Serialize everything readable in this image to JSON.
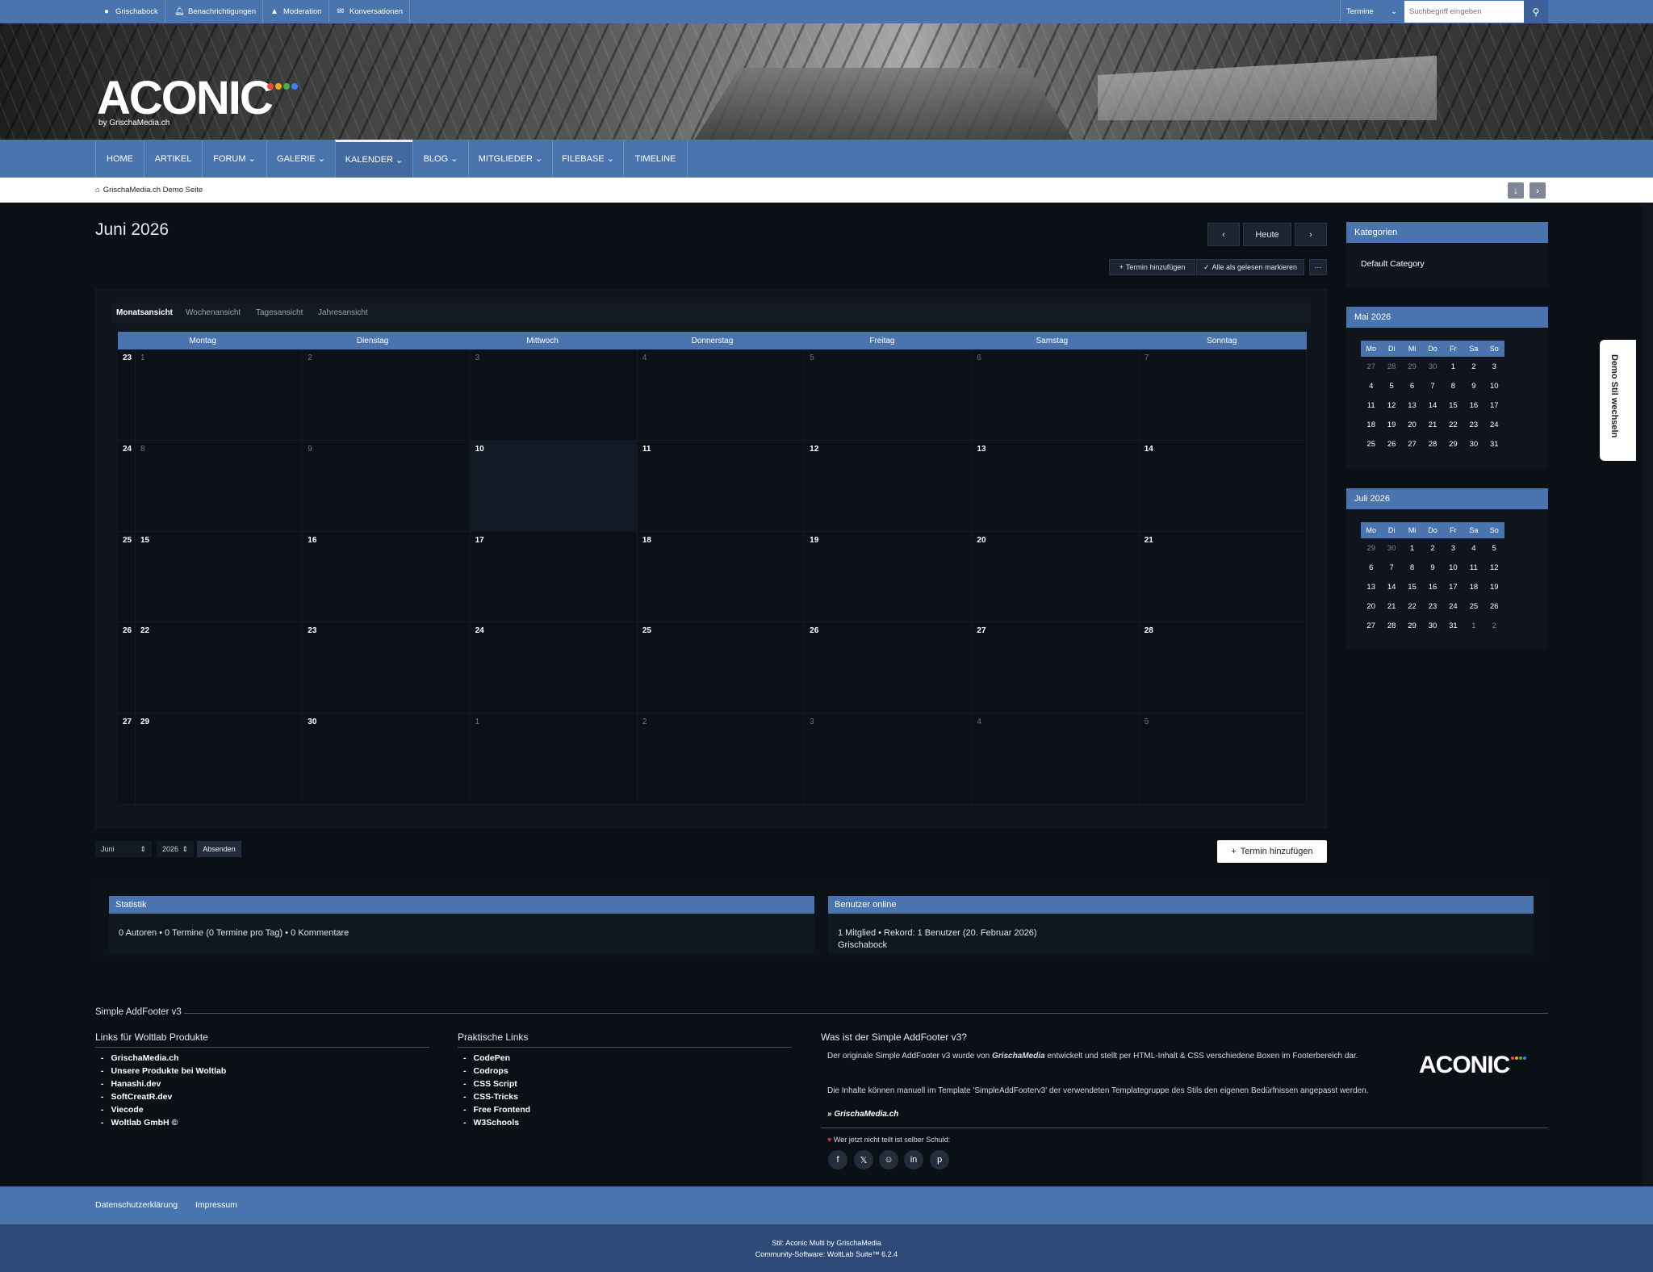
{
  "userbar": {
    "items": [
      "Grischabock",
      "Benachrichtigungen",
      "Moderation",
      "Konversationen"
    ],
    "search_scope": "Termine",
    "search_placeholder": "Suchbegriff eingeben"
  },
  "header": {
    "logo": "ACONIC",
    "logo_sub": "by GrischaMedia.ch",
    "dot_colors": [
      "#e94b35",
      "#f2a81d",
      "#4caf50",
      "#3b82f6"
    ]
  },
  "nav": [
    "HOME",
    "ARTIKEL",
    "FORUM",
    "GALERIE",
    "KALENDER",
    "BLOG",
    "MITGLIEDER",
    "FILEBASE",
    "TIMELINE"
  ],
  "breadcrumb": "GrischaMedia.ch Demo Seite",
  "calendar": {
    "title": "Juni 2026",
    "today_label": "Heute",
    "add_event": "Termin hinzufügen",
    "mark_read": "Alle als gelesen markieren",
    "more": "···",
    "tabs": [
      "Monatsansicht",
      "Wochenansicht",
      "Tagesansicht",
      "Jahresansicht"
    ],
    "weekdays": [
      "Montag",
      "Dienstag",
      "Mittwoch",
      "Donnerstag",
      "Freitag",
      "Samstag",
      "Sonntag"
    ],
    "weeks": [
      {
        "kw": "23",
        "days": [
          "1",
          "2",
          "3",
          "4",
          "5",
          "6",
          "7"
        ],
        "other": [
          true,
          true,
          true,
          true,
          true,
          true,
          true
        ]
      },
      {
        "kw": "24",
        "days": [
          "8",
          "9",
          "10",
          "11",
          "12",
          "13",
          "14"
        ],
        "other": [
          true,
          true,
          false,
          false,
          false,
          false,
          false
        ]
      },
      {
        "kw": "25",
        "days": [
          "15",
          "16",
          "17",
          "18",
          "19",
          "20",
          "21"
        ],
        "other": [
          false,
          false,
          false,
          false,
          false,
          false,
          false
        ]
      },
      {
        "kw": "26",
        "days": [
          "22",
          "23",
          "24",
          "25",
          "26",
          "27",
          "28"
        ],
        "other": [
          false,
          false,
          false,
          false,
          false,
          false,
          false
        ]
      },
      {
        "kw": "27",
        "days": [
          "29",
          "30",
          "1",
          "2",
          "3",
          "4",
          "5"
        ],
        "other": [
          false,
          false,
          true,
          true,
          true,
          true,
          true
        ]
      }
    ],
    "month_select": "Juni",
    "year_select": "2026",
    "submit": "Absenden"
  },
  "sidebar": {
    "categories_title": "Kategorien",
    "category": "Default Category",
    "mini_head": [
      "Mo",
      "Di",
      "Mi",
      "Do",
      "Fr",
      "Sa",
      "So"
    ],
    "may": {
      "title": "Mai 2026",
      "rows": [
        [
          "27",
          "28",
          "29",
          "30",
          "1",
          "2",
          "3"
        ],
        [
          "4",
          "5",
          "6",
          "7",
          "8",
          "9",
          "10"
        ],
        [
          "11",
          "12",
          "13",
          "14",
          "15",
          "16",
          "17"
        ],
        [
          "18",
          "19",
          "20",
          "21",
          "22",
          "23",
          "24"
        ],
        [
          "25",
          "26",
          "27",
          "28",
          "29",
          "30",
          "31"
        ]
      ],
      "other_first_row": 4
    },
    "june": {
      "title": "Juli 2026",
      "rows": [
        [
          "29",
          "30",
          "1",
          "2",
          "3",
          "4",
          "5"
        ],
        [
          "6",
          "7",
          "8",
          "9",
          "10",
          "11",
          "12"
        ],
        [
          "13",
          "14",
          "15",
          "16",
          "17",
          "18",
          "19"
        ],
        [
          "20",
          "21",
          "22",
          "23",
          "24",
          "25",
          "26"
        ],
        [
          "27",
          "28",
          "29",
          "30",
          "31",
          "1",
          "2"
        ]
      ]
    }
  },
  "demo_tab": "Demo Stil wechseln",
  "stats": {
    "title": "Statistik",
    "text": "0 Autoren  •  0 Termine (0 Termine pro Tag)  •  0 Kommentare"
  },
  "online": {
    "title": "Benutzer online",
    "text": "1 Mitglied  •  Rekord: 1 Benutzer (20. Februar 2026)",
    "user": "Grischabock"
  },
  "addfooter": {
    "title": "Simple AddFooter v3",
    "col1_title": "Links für Woltlab Produkte",
    "col1": [
      "GrischaMedia.ch",
      "Unsere Produkte bei Woltlab",
      "Hanashi.dev",
      "SoftCreatR.dev",
      "Viecode",
      "Woltlab GmbH ©"
    ],
    "col2_title": "Praktische Links",
    "col2": [
      "CodePen",
      "Codrops",
      "CSS Script",
      "CSS-Tricks",
      "Free Frontend",
      "W3Schools"
    ],
    "col3_title": "Was ist der Simple AddFooter v3?",
    "p1a": "Der originale Simple AddFooter v3 wurde von ",
    "p1b": "GrischaMedia",
    "p1c": " entwickelt und stellt per HTML-Inhalt & CSS verschiedene Boxen im Footerbereich dar.",
    "p2": "Die Inhalte können manuell im Template 'SimpleAddFooterv3' der verwendeten Templategruppe des Stils den eigenen Bedürfnissen angepasst werden.",
    "link": "» GrischaMedia.ch",
    "logo": "ACONIC",
    "share_text": "Wer jetzt nicht teilt ist selber Schuld:",
    "share_icons": [
      "f",
      "𝕏",
      "r",
      "in",
      "p"
    ]
  },
  "footer": {
    "links": [
      "Datenschutzerklärung",
      "Impressum"
    ],
    "line1": "Stil: Aconic Multi by GrischaMedia",
    "line2": "Community-Software: WoltLab Suite™ 6.2.4"
  }
}
